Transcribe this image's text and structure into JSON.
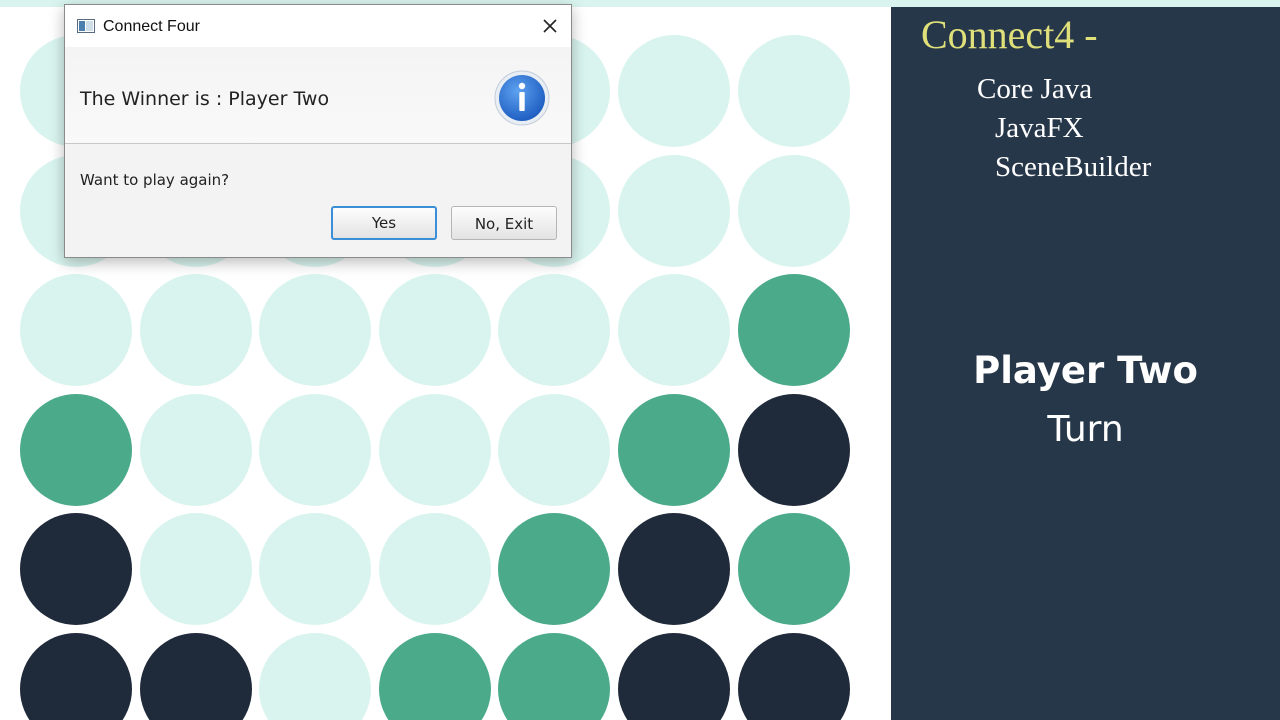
{
  "colors": {
    "empty": "#d9f4ee",
    "green": "#4aaa89",
    "dark": "#1f2a3a",
    "panel": "#27374a",
    "title": "#dfe07a"
  },
  "board": {
    "rows": [
      [
        "empty",
        "empty",
        "empty",
        "empty",
        "empty",
        "empty",
        "empty"
      ],
      [
        "empty",
        "empty",
        "empty",
        "empty",
        "empty",
        "empty",
        "empty"
      ],
      [
        "empty",
        "empty",
        "empty",
        "empty",
        "empty",
        "empty",
        "green"
      ],
      [
        "green",
        "empty",
        "empty",
        "empty",
        "empty",
        "green",
        "dark"
      ],
      [
        "dark",
        "empty",
        "empty",
        "empty",
        "green",
        "dark",
        "green"
      ],
      [
        "dark",
        "dark",
        "empty",
        "green",
        "green",
        "dark",
        "dark"
      ]
    ]
  },
  "sidebar": {
    "title": "Connect4 -",
    "tech_items": [
      "Core Java",
      "JavaFX",
      "SceneBuilder"
    ],
    "player": "Player Two",
    "turn_label": "Turn"
  },
  "dialog": {
    "title": "Connect Four",
    "close_icon": "close-icon",
    "header_text": "The Winner is : Player Two",
    "header_icon": "info-icon",
    "content_text": "Want to play again?",
    "yes_label": "Yes",
    "no_label": "No, Exit"
  }
}
